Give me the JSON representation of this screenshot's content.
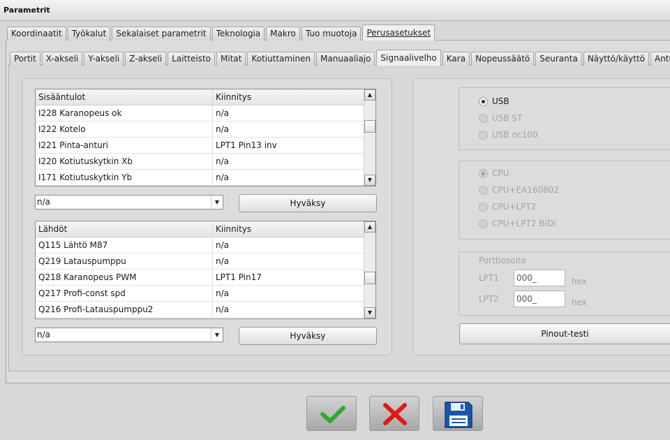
{
  "window": {
    "title": "Parametrit"
  },
  "main_tabs": [
    "Koordinaatit",
    "Työkalut",
    "Sekalaiset parametrit",
    "Teknologia",
    "Makro",
    "Tuo muotoja",
    "Perusasetukset"
  ],
  "sub_tabs": [
    "Portit",
    "X-akseli",
    "Y-akseli",
    "Z-akseli",
    "Laitteisto",
    "Mitat",
    "Kotiuttaminen",
    "Manuaaliajo",
    "Signaalivelho",
    "Kara",
    "Nopeussäätö",
    "Seuranta",
    "Näyttö/käyttö",
    "Anturi"
  ],
  "inputs_table": {
    "headers": [
      "Sisääntulot",
      "Kiinnitys"
    ],
    "rows": [
      [
        "I228 Karanopeus ok",
        "n/a"
      ],
      [
        "I222 Kotelo",
        "n/a"
      ],
      [
        "I221 Pinta-anturi",
        "LPT1 Pin13 inv"
      ],
      [
        "I220 Kotiutuskytkin Xb",
        "n/a"
      ],
      [
        "I171 Kotiutuskytkin Yb",
        "n/a"
      ]
    ],
    "combo_value": "n/a",
    "accept_label": "Hyväksy"
  },
  "outputs_table": {
    "headers": [
      "Lähdöt",
      "Kiinnitys"
    ],
    "rows": [
      [
        "Q115 Lähtö M87",
        "n/a"
      ],
      [
        "Q219 Latauspumppu",
        "n/a"
      ],
      [
        "Q218 Karanopeus PWM",
        "LPT1 Pin17"
      ],
      [
        "Q217 Profi-const spd",
        "n/a"
      ],
      [
        "Q216 Profi-Latauspumppu2",
        "n/a"
      ]
    ],
    "combo_value": "n/a",
    "accept_label": "Hyväksy"
  },
  "interface": {
    "options": [
      {
        "label": "USB",
        "selected": true,
        "enabled": true
      },
      {
        "label": "USB ST",
        "selected": false,
        "enabled": false
      },
      {
        "label": "USB nc100",
        "selected": false,
        "enabled": false
      }
    ]
  },
  "processor": {
    "options": [
      {
        "label": "CPU",
        "selected": true,
        "enabled": false
      },
      {
        "label": "CPU+EA160802",
        "selected": false,
        "enabled": false
      },
      {
        "label": "CPU+LPT2",
        "selected": false,
        "enabled": false
      },
      {
        "label": "CPU+LPT2 BiDi",
        "selected": false,
        "enabled": false
      }
    ]
  },
  "port_address": {
    "title": "Porttiosoite",
    "lpt1_label": "LPT1",
    "lpt1_value": "000_",
    "lpt2_label": "LPT2",
    "lpt2_value": "000_",
    "unit": "hex"
  },
  "pinout_test_label": "Pinout-testi",
  "actions": {
    "ok_icon": "checkmark-icon",
    "cancel_icon": "cross-icon",
    "save_icon": "floppy-disk-icon",
    "ok_color": "#2eab2e",
    "cancel_color": "#e01818",
    "save_color": "#1c56a8"
  }
}
